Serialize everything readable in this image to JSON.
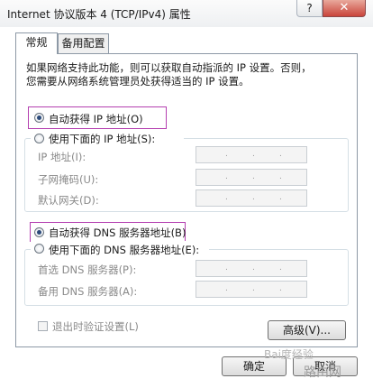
{
  "window": {
    "title": "Internet 协议版本 4 (TCP/IPv4) 属性",
    "help_label": "?",
    "close_label": "✕"
  },
  "tabs": [
    {
      "label": "常规",
      "active": true
    },
    {
      "label": "备用配置",
      "active": false
    }
  ],
  "description": {
    "line1": "如果网络支持此功能，则可以获取自动指派的 IP 设置。否则，",
    "line2": "您需要从网络系统管理员处获得适当的 IP 设置。"
  },
  "ip_section": {
    "auto_label": "自动获得 IP 地址(O)",
    "auto_selected": true,
    "manual_label": "使用下面的 IP 地址(S):",
    "fields": [
      {
        "label": "IP 地址(I):"
      },
      {
        "label": "子网掩码(U):"
      },
      {
        "label": "默认网关(D):"
      }
    ]
  },
  "dns_section": {
    "auto_label": "自动获得 DNS 服务器地址(B)",
    "auto_selected": true,
    "manual_label": "使用下面的 DNS 服务器地址(E):",
    "fields": [
      {
        "label": "首选 DNS 服务器(P):"
      },
      {
        "label": "备用 DNS 服务器(A):"
      }
    ]
  },
  "validate_checkbox": {
    "label": "退出时验证设置(L)",
    "checked": false
  },
  "advanced_button": {
    "label": "高级(V)..."
  },
  "footer": {
    "ok_label": "确定",
    "cancel_label": "取消"
  },
  "watermarks": {
    "baidu": "Bai度经验",
    "site": "路由网"
  }
}
